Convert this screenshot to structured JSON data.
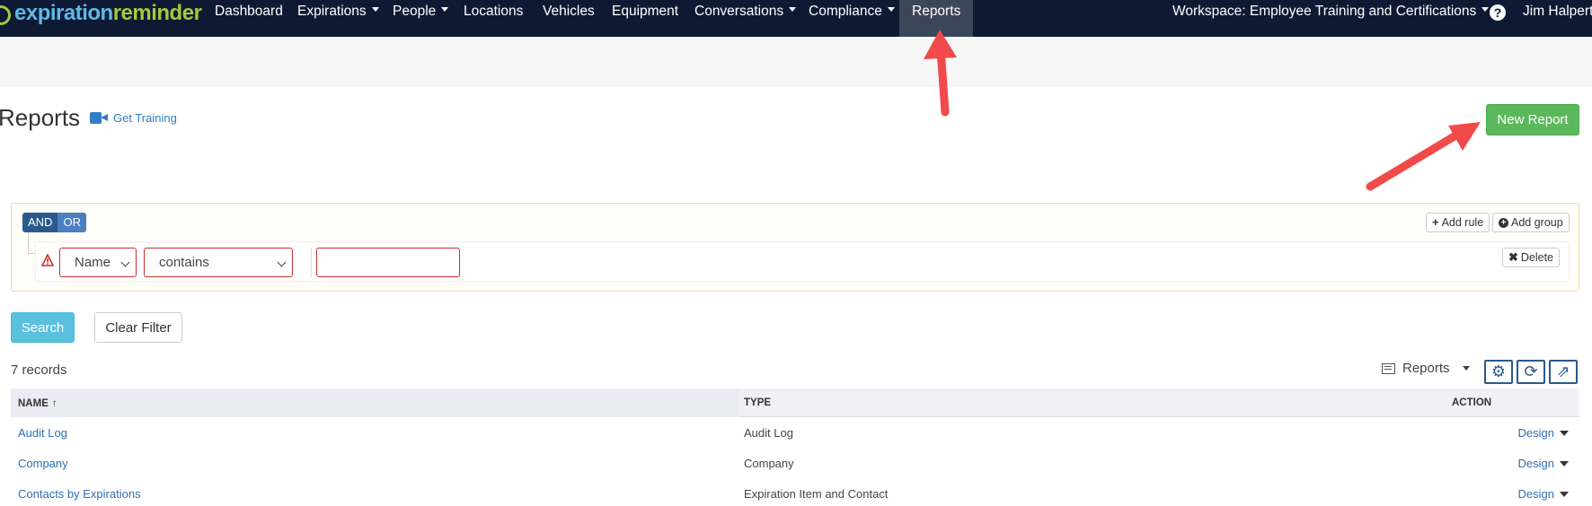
{
  "nav": {
    "brand_part1": "expiration",
    "brand_part2": "reminder",
    "items": {
      "dashboard": "Dashboard",
      "expirations": "Expirations",
      "people": "People",
      "locations": "Locations",
      "vehicles": "Vehicles",
      "equipment": "Equipment",
      "conversations": "Conversations",
      "compliance": "Compliance",
      "reports": "Reports"
    },
    "workspace": "Workspace: Employee Training and Certifications",
    "user": "Jim Halpert",
    "help": "?"
  },
  "header": {
    "title": "Reports",
    "training": "Get Training",
    "new_report": "New Report"
  },
  "filter": {
    "and": "AND",
    "or": "OR",
    "add_rule": "Add rule",
    "add_group": "Add group",
    "field": "Name",
    "operator": "contains",
    "value": "",
    "delete": "Delete"
  },
  "actions": {
    "search": "Search",
    "clear": "Clear Filter"
  },
  "records": {
    "count": "7 records",
    "view": "Reports"
  },
  "table": {
    "headers": {
      "name": "NAME",
      "type": "TYPE",
      "action": "ACTION"
    },
    "rows": [
      {
        "name": "Audit Log",
        "type": "Audit Log",
        "action": "Design"
      },
      {
        "name": "Company",
        "type": "Company",
        "action": "Design"
      },
      {
        "name": "Contacts by Expirations",
        "type": "Expiration Item and Contact",
        "action": "Design"
      }
    ]
  },
  "colors": {
    "navbar": "#0e1a33",
    "accent_green": "#5cb85c",
    "accent_blue": "#5bc0de",
    "link": "#2f6fb5",
    "arrow": "#f04a4a"
  }
}
